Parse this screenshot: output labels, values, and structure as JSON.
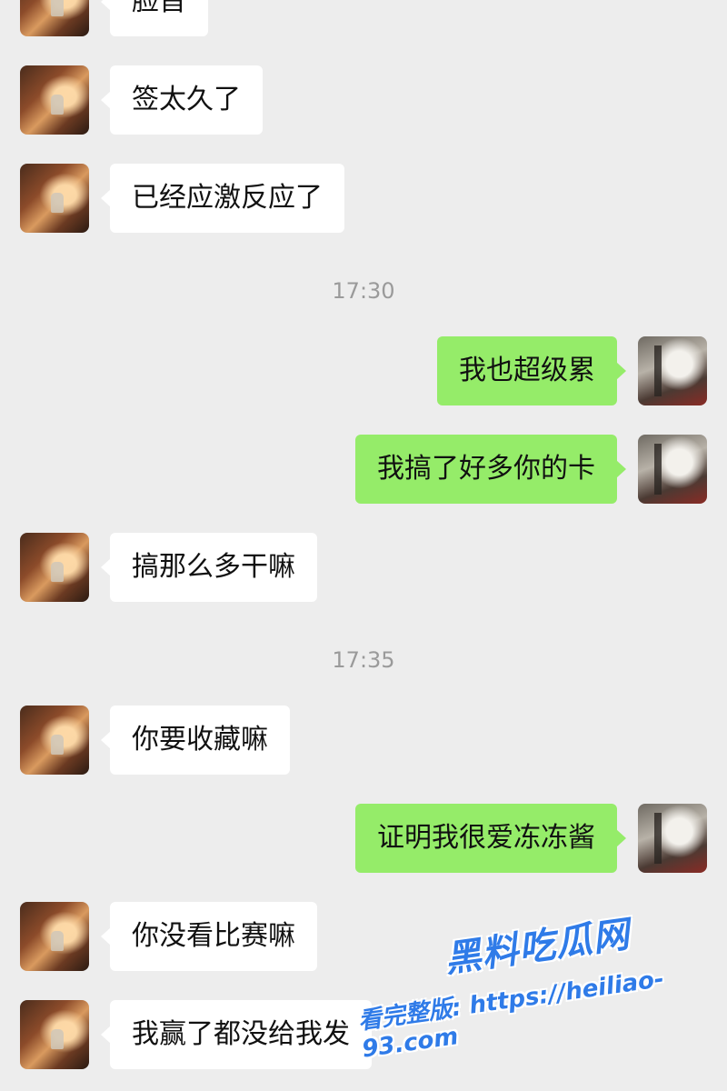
{
  "messages": [
    {
      "side": "left",
      "text": "脸首"
    },
    {
      "side": "left",
      "text": "签太久了"
    },
    {
      "side": "left",
      "text": "已经应激反应了"
    },
    {
      "side": "right",
      "text": "我也超级累"
    },
    {
      "side": "right",
      "text": "我搞了好多你的卡"
    },
    {
      "side": "left",
      "text": "搞那么多干嘛"
    },
    {
      "side": "left",
      "text": "你要收藏嘛"
    },
    {
      "side": "right",
      "text": "证明我很爱冻冻酱"
    },
    {
      "side": "left",
      "text": "你没看比赛嘛"
    },
    {
      "side": "left",
      "text": "我赢了都没给我发"
    }
  ],
  "timestamps": [
    "17:30",
    "17:35"
  ],
  "watermark": {
    "brand": "黑料吃瓜网",
    "line": "看完整版: https://heiliao-93.com"
  },
  "colors": {
    "background": "#ededed",
    "incoming_bubble": "#ffffff",
    "outgoing_bubble": "#95ec69",
    "timestamp": "#9a9a9a",
    "watermark": "#2f7be8"
  },
  "icons": {
    "friend_avatar": "friend-avatar-photo",
    "my_avatar": "my-avatar-photo"
  }
}
